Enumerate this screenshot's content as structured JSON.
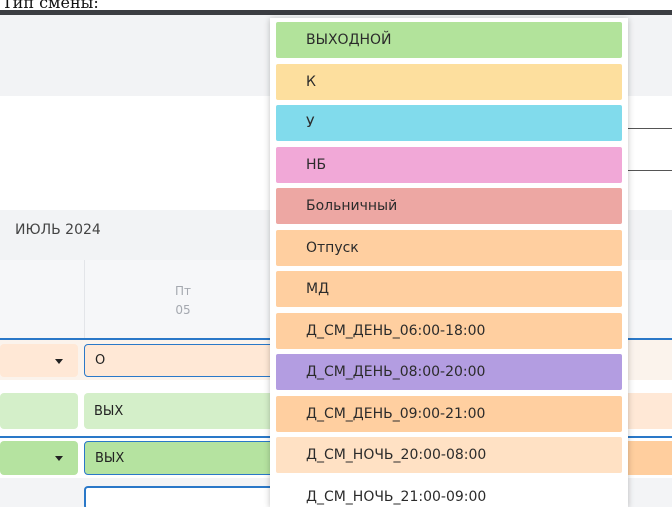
{
  "header": {
    "caption": "Тип смены:"
  },
  "calendar": {
    "month": "ИЮЛЬ 2024",
    "day": {
      "name": "Пт",
      "number": "05"
    }
  },
  "rows": [
    {
      "left_value": "",
      "cell_value": "О",
      "left_color": "#ffe8d6",
      "cell_color": "#ffe8d6",
      "right_color": "#ffe8d6"
    },
    {
      "left_value": "",
      "cell_value": "ВЫХ",
      "left_color": "#d4efc9",
      "cell_color": "#d4efc9",
      "right_color": "#ffe8d6"
    },
    {
      "left_value": "",
      "cell_value": "ВЫХ",
      "left_color": "#b5e3a0",
      "cell_color": "#b5e3a0",
      "right_color": "#ffce9e"
    },
    {
      "left_value": "",
      "cell_value": "",
      "left_color": "#ffffff",
      "cell_color": "#ffffff",
      "right_color": "#ffffff"
    }
  ],
  "dropdown": {
    "options": [
      {
        "label": "ВЫХОДНОЙ",
        "color": "#b2e39b"
      },
      {
        "label": "К",
        "color": "#fddf9e"
      },
      {
        "label": "У",
        "color": "#81dbec"
      },
      {
        "label": "НБ",
        "color": "#f1a8d7"
      },
      {
        "label": "Больничный",
        "color": "#eda7a3"
      },
      {
        "label": "Отпуск",
        "color": "#ffcfa0"
      },
      {
        "label": "МД",
        "color": "#ffcfa0"
      },
      {
        "label": "Д_СМ_ДЕНЬ_06:00-18:00",
        "color": "#ffcfa0"
      },
      {
        "label": "Д_СМ_ДЕНЬ_08:00-20:00",
        "color": "#b39de1"
      },
      {
        "label": "Д_СМ_ДЕНЬ_09:00-21:00",
        "color": "#ffcfa0"
      },
      {
        "label": "Д_СМ_НОЧЬ_20:00-08:00",
        "color": "#ffe1c4"
      },
      {
        "label": "Д_СМ_НОЧЬ_21:00-09:00",
        "color": "#ffffff"
      }
    ]
  }
}
